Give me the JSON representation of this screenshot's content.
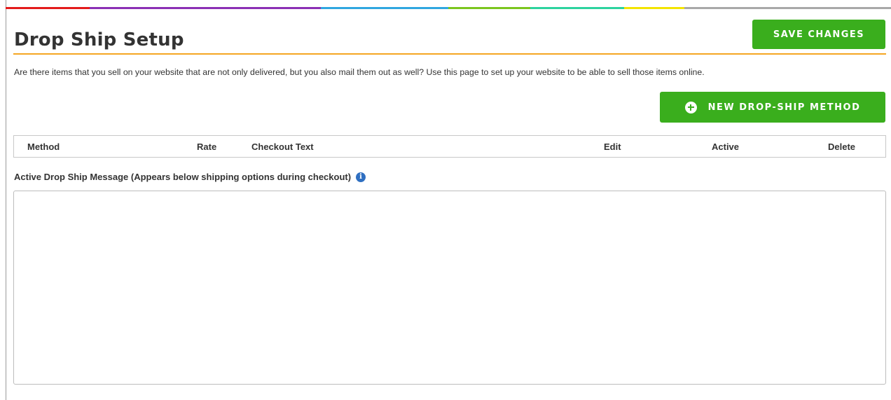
{
  "theme": {
    "accent": "#f5a623",
    "button_green": "#3aae1d",
    "info_blue": "#2f6fc1",
    "rainbow": [
      "#e31b1b",
      "#8b2fb5",
      "#2fa6e0",
      "#7bc61e",
      "#2dd39f",
      "#f3e400",
      "#a8a8a8"
    ]
  },
  "page": {
    "title": "Drop Ship Setup",
    "description": "Are there items that you sell on your website that are not only delivered, but you also mail them out as well? Use this page to set up your website to be able to sell those items online."
  },
  "toolbar": {
    "save_label": "SAVE CHANGES",
    "new_method_label": "NEW DROP-SHIP METHOD",
    "new_method_icon": "plus-circle-icon"
  },
  "table": {
    "columns": [
      "Method",
      "Rate",
      "Checkout Text",
      "Edit",
      "Active",
      "Delete"
    ],
    "rows": []
  },
  "message": {
    "label": "Active Drop Ship Message (Appears below shipping options during checkout)",
    "info_icon": "info-icon",
    "info_glyph": "i",
    "value": ""
  }
}
